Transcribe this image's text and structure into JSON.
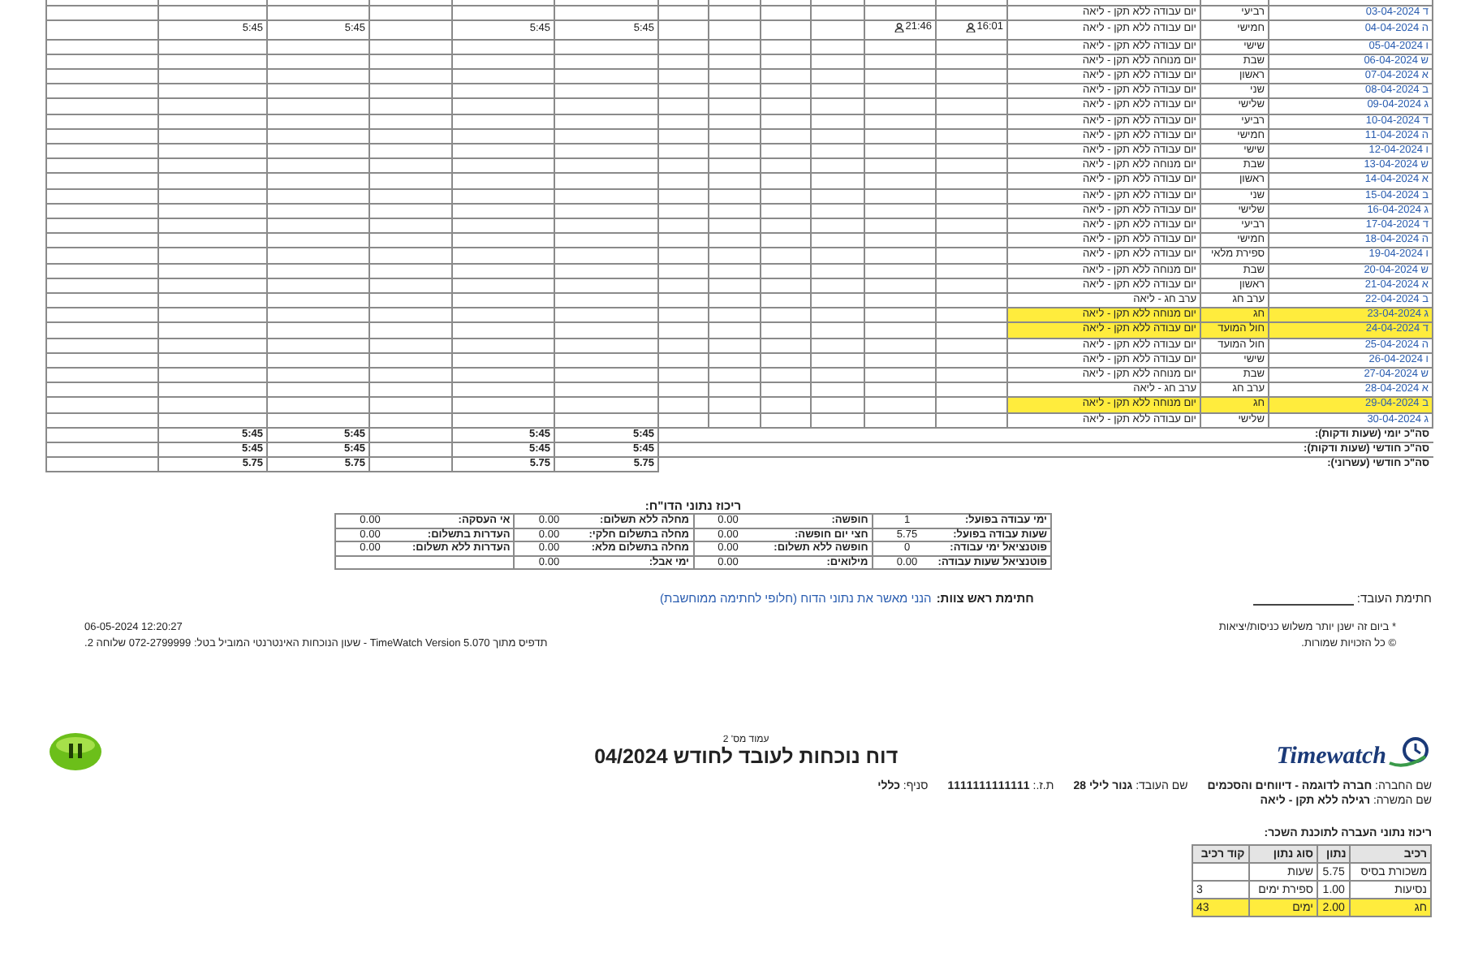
{
  "daily_table": {
    "rows": [
      {
        "date": "ד 03-04-2024",
        "day_type": "רביעי",
        "status": "יום עבודה ללא תקן - ליאה",
        "highlighted": false
      },
      {
        "date": "ה 04-04-2024",
        "day_type": "חמישי",
        "status": "יום עבודה ללא תקן - ליאה",
        "time_in": "16:01",
        "time_out": "21:46",
        "hours": [
          "5:45",
          "5:45",
          "5:45",
          "5:45"
        ],
        "highlighted": false
      },
      {
        "date": "ו 05-04-2024",
        "day_type": "שישי",
        "status": "יום עבודה ללא תקן - ליאה",
        "highlighted": false
      },
      {
        "date": "ש 06-04-2024",
        "day_type": "שבת",
        "status": "יום מנוחה ללא תקן - ליאה",
        "highlighted": false
      },
      {
        "date": "א 07-04-2024",
        "day_type": "ראשון",
        "status": "יום עבודה ללא תקן - ליאה",
        "highlighted": false
      },
      {
        "date": "ב 08-04-2024",
        "day_type": "שני",
        "status": "יום עבודה ללא תקן - ליאה",
        "highlighted": false
      },
      {
        "date": "ג 09-04-2024",
        "day_type": "שלישי",
        "status": "יום עבודה ללא תקן - ליאה",
        "highlighted": false
      },
      {
        "date": "ד 10-04-2024",
        "day_type": "רביעי",
        "status": "יום עבודה ללא תקן - ליאה",
        "highlighted": false
      },
      {
        "date": "ה 11-04-2024",
        "day_type": "חמישי",
        "status": "יום עבודה ללא תקן - ליאה",
        "highlighted": false
      },
      {
        "date": "ו 12-04-2024",
        "day_type": "שישי",
        "status": "יום עבודה ללא תקן - ליאה",
        "highlighted": false
      },
      {
        "date": "ש 13-04-2024",
        "day_type": "שבת",
        "status": "יום מנוחה ללא תקן - ליאה",
        "highlighted": false
      },
      {
        "date": "א 14-04-2024",
        "day_type": "ראשון",
        "status": "יום עבודה ללא תקן - ליאה",
        "highlighted": false
      },
      {
        "date": "ב 15-04-2024",
        "day_type": "שני",
        "status": "יום עבודה ללא תקן - ליאה",
        "highlighted": false
      },
      {
        "date": "ג 16-04-2024",
        "day_type": "שלישי",
        "status": "יום עבודה ללא תקן - ליאה",
        "highlighted": false
      },
      {
        "date": "ד 17-04-2024",
        "day_type": "רביעי",
        "status": "יום עבודה ללא תקן - ליאה",
        "highlighted": false
      },
      {
        "date": "ה 18-04-2024",
        "day_type": "חמישי",
        "status": "יום עבודה ללא תקן - ליאה",
        "highlighted": false
      },
      {
        "date": "ו 19-04-2024",
        "day_type": "ספירת מלאי",
        "status": "יום עבודה ללא תקן - ליאה",
        "highlighted": false
      },
      {
        "date": "ש 20-04-2024",
        "day_type": "שבת",
        "status": "יום מנוחה ללא תקן - ליאה",
        "highlighted": false
      },
      {
        "date": "א 21-04-2024",
        "day_type": "ראשון",
        "status": "יום עבודה ללא תקן - ליאה",
        "highlighted": false
      },
      {
        "date": "ב 22-04-2024",
        "day_type": "ערב חג",
        "status": "ערב חג - ליאה",
        "highlighted": false
      },
      {
        "date": "ג 23-04-2024",
        "day_type": "חג",
        "status": "יום מנוחה ללא תקן - ליאה",
        "highlighted": true
      },
      {
        "date": "ד 24-04-2024",
        "day_type": "חול המועד",
        "status": "יום עבודה ללא תקן - ליאה",
        "highlighted": true
      },
      {
        "date": "ה 25-04-2024",
        "day_type": "חול המועד",
        "status": "יום עבודה ללא תקן - ליאה",
        "highlighted": false
      },
      {
        "date": "ו 26-04-2024",
        "day_type": "שישי",
        "status": "יום עבודה ללא תקן - ליאה",
        "highlighted": false
      },
      {
        "date": "ש 27-04-2024",
        "day_type": "שבת",
        "status": "יום מנוחה ללא תקן - ליאה",
        "highlighted": false
      },
      {
        "date": "א 28-04-2024",
        "day_type": "ערב חג",
        "status": "ערב חג - ליאה",
        "highlighted": false
      },
      {
        "date": "ב 29-04-2024",
        "day_type": "חג",
        "status": "יום מנוחה ללא תקן - ליאה",
        "highlighted": true
      },
      {
        "date": "ג 30-04-2024",
        "day_type": "שלישי",
        "status": "יום עבודה ללא תקן - ליאה",
        "highlighted": false
      }
    ],
    "totals": [
      {
        "label": "סה\"כ יומי (שעות ודקות):",
        "values": [
          "5:45",
          "5:45",
          "5:45",
          "5:45"
        ]
      },
      {
        "label": "סה\"כ חודשי (שעות ודקות):",
        "values": [
          "5:45",
          "5:45",
          "5:45",
          "5:45"
        ]
      },
      {
        "label": "סה\"כ חודשי (עשרוני):",
        "values": [
          "5.75",
          "5.75",
          "5.75",
          "5.75"
        ]
      }
    ]
  },
  "report_summary": {
    "title": "ריכוז נתוני הדו\"ח:",
    "groups": [
      {
        "items": [
          {
            "label": "ימי עבודה בפועל:",
            "value": "1"
          },
          {
            "label": "שעות עבודה בפועל:",
            "value": "5.75"
          },
          {
            "label": "פוטנציאל ימי עבודה:",
            "value": "0"
          },
          {
            "label": "פוטנציאל שעות עבודה:",
            "value": "0.00"
          }
        ]
      },
      {
        "items": [
          {
            "label": "חופשה:",
            "value": "0.00"
          },
          {
            "label": "חצי יום חופשה:",
            "value": "0.00"
          },
          {
            "label": "חופשה ללא תשלום:",
            "value": "0.00"
          },
          {
            "label": "מילואים:",
            "value": "0.00"
          }
        ]
      },
      {
        "items": [
          {
            "label": "מחלה ללא תשלום:",
            "value": "0.00"
          },
          {
            "label": "מחלה בתשלום חלקי:",
            "value": "0.00"
          },
          {
            "label": "מחלה בתשלום מלא:",
            "value": "0.00"
          },
          {
            "label": "ימי אבל:",
            "value": "0.00"
          }
        ]
      },
      {
        "items": [
          {
            "label": "אי העסקה:",
            "value": "0.00"
          },
          {
            "label": "העדרות בתשלום:",
            "value": "0.00"
          },
          {
            "label": "העדרות ללא תשלום:",
            "value": "0.00"
          }
        ]
      }
    ]
  },
  "signatures": {
    "employee_label": "חתימת העובד:",
    "manager_label": "חתימת ראש צוות:",
    "manager_note": "הנני מאשר את נתוני הדוח (חלופי לחתימה ממוחשבת)"
  },
  "footer": {
    "notes": [
      "* ביום זה ישנן יותר משלוש כניסות/יציאות",
      "© כל הזכויות שמורות."
    ],
    "printed_at": "06-05-2024 12:20:27",
    "print_source": "תדפיס מתוך TimeWatch Version 5.070 - שעון הנוכחות האינטרנטי המוביל בטל: 072-2799999 שלוחה 2."
  },
  "page_two": {
    "page_number": "עמוד מס' 2",
    "title": "דוח נוכחות לעובד לחודש 04/2024",
    "logo": "Timewatch",
    "info_lines": [
      [
        {
          "label": "שם החברה:",
          "value": "חברה לדוגמה - דיווחים והסכמים"
        },
        {
          "label": "שם העובד:",
          "value": "גנור לילי 28"
        },
        {
          "label": "ת.ז.:",
          "value": "1111111111111"
        },
        {
          "label": "סניף:",
          "value": "כללי"
        }
      ],
      [
        {
          "label": "שם המשרה:",
          "value": "רגילה ללא תקן - ליאה"
        }
      ]
    ],
    "payroll": {
      "title": "ריכוז נתוני העברה לתוכנת השכר:",
      "columns": [
        "רכיב",
        "נתון",
        "סוג נתון",
        "קוד רכיב"
      ],
      "rows": [
        {
          "component": "משכורת בסיס",
          "amount": "5.75",
          "data_type": "שעות",
          "highlighted": false
        },
        {
          "component": "נסיעות",
          "amount": "1.00",
          "data_type": "ספירת ימים",
          "code": "3",
          "highlighted": false
        },
        {
          "component": "חג",
          "amount": "2.00",
          "data_type": "ימים",
          "code": "43",
          "highlighted": true
        }
      ]
    }
  }
}
